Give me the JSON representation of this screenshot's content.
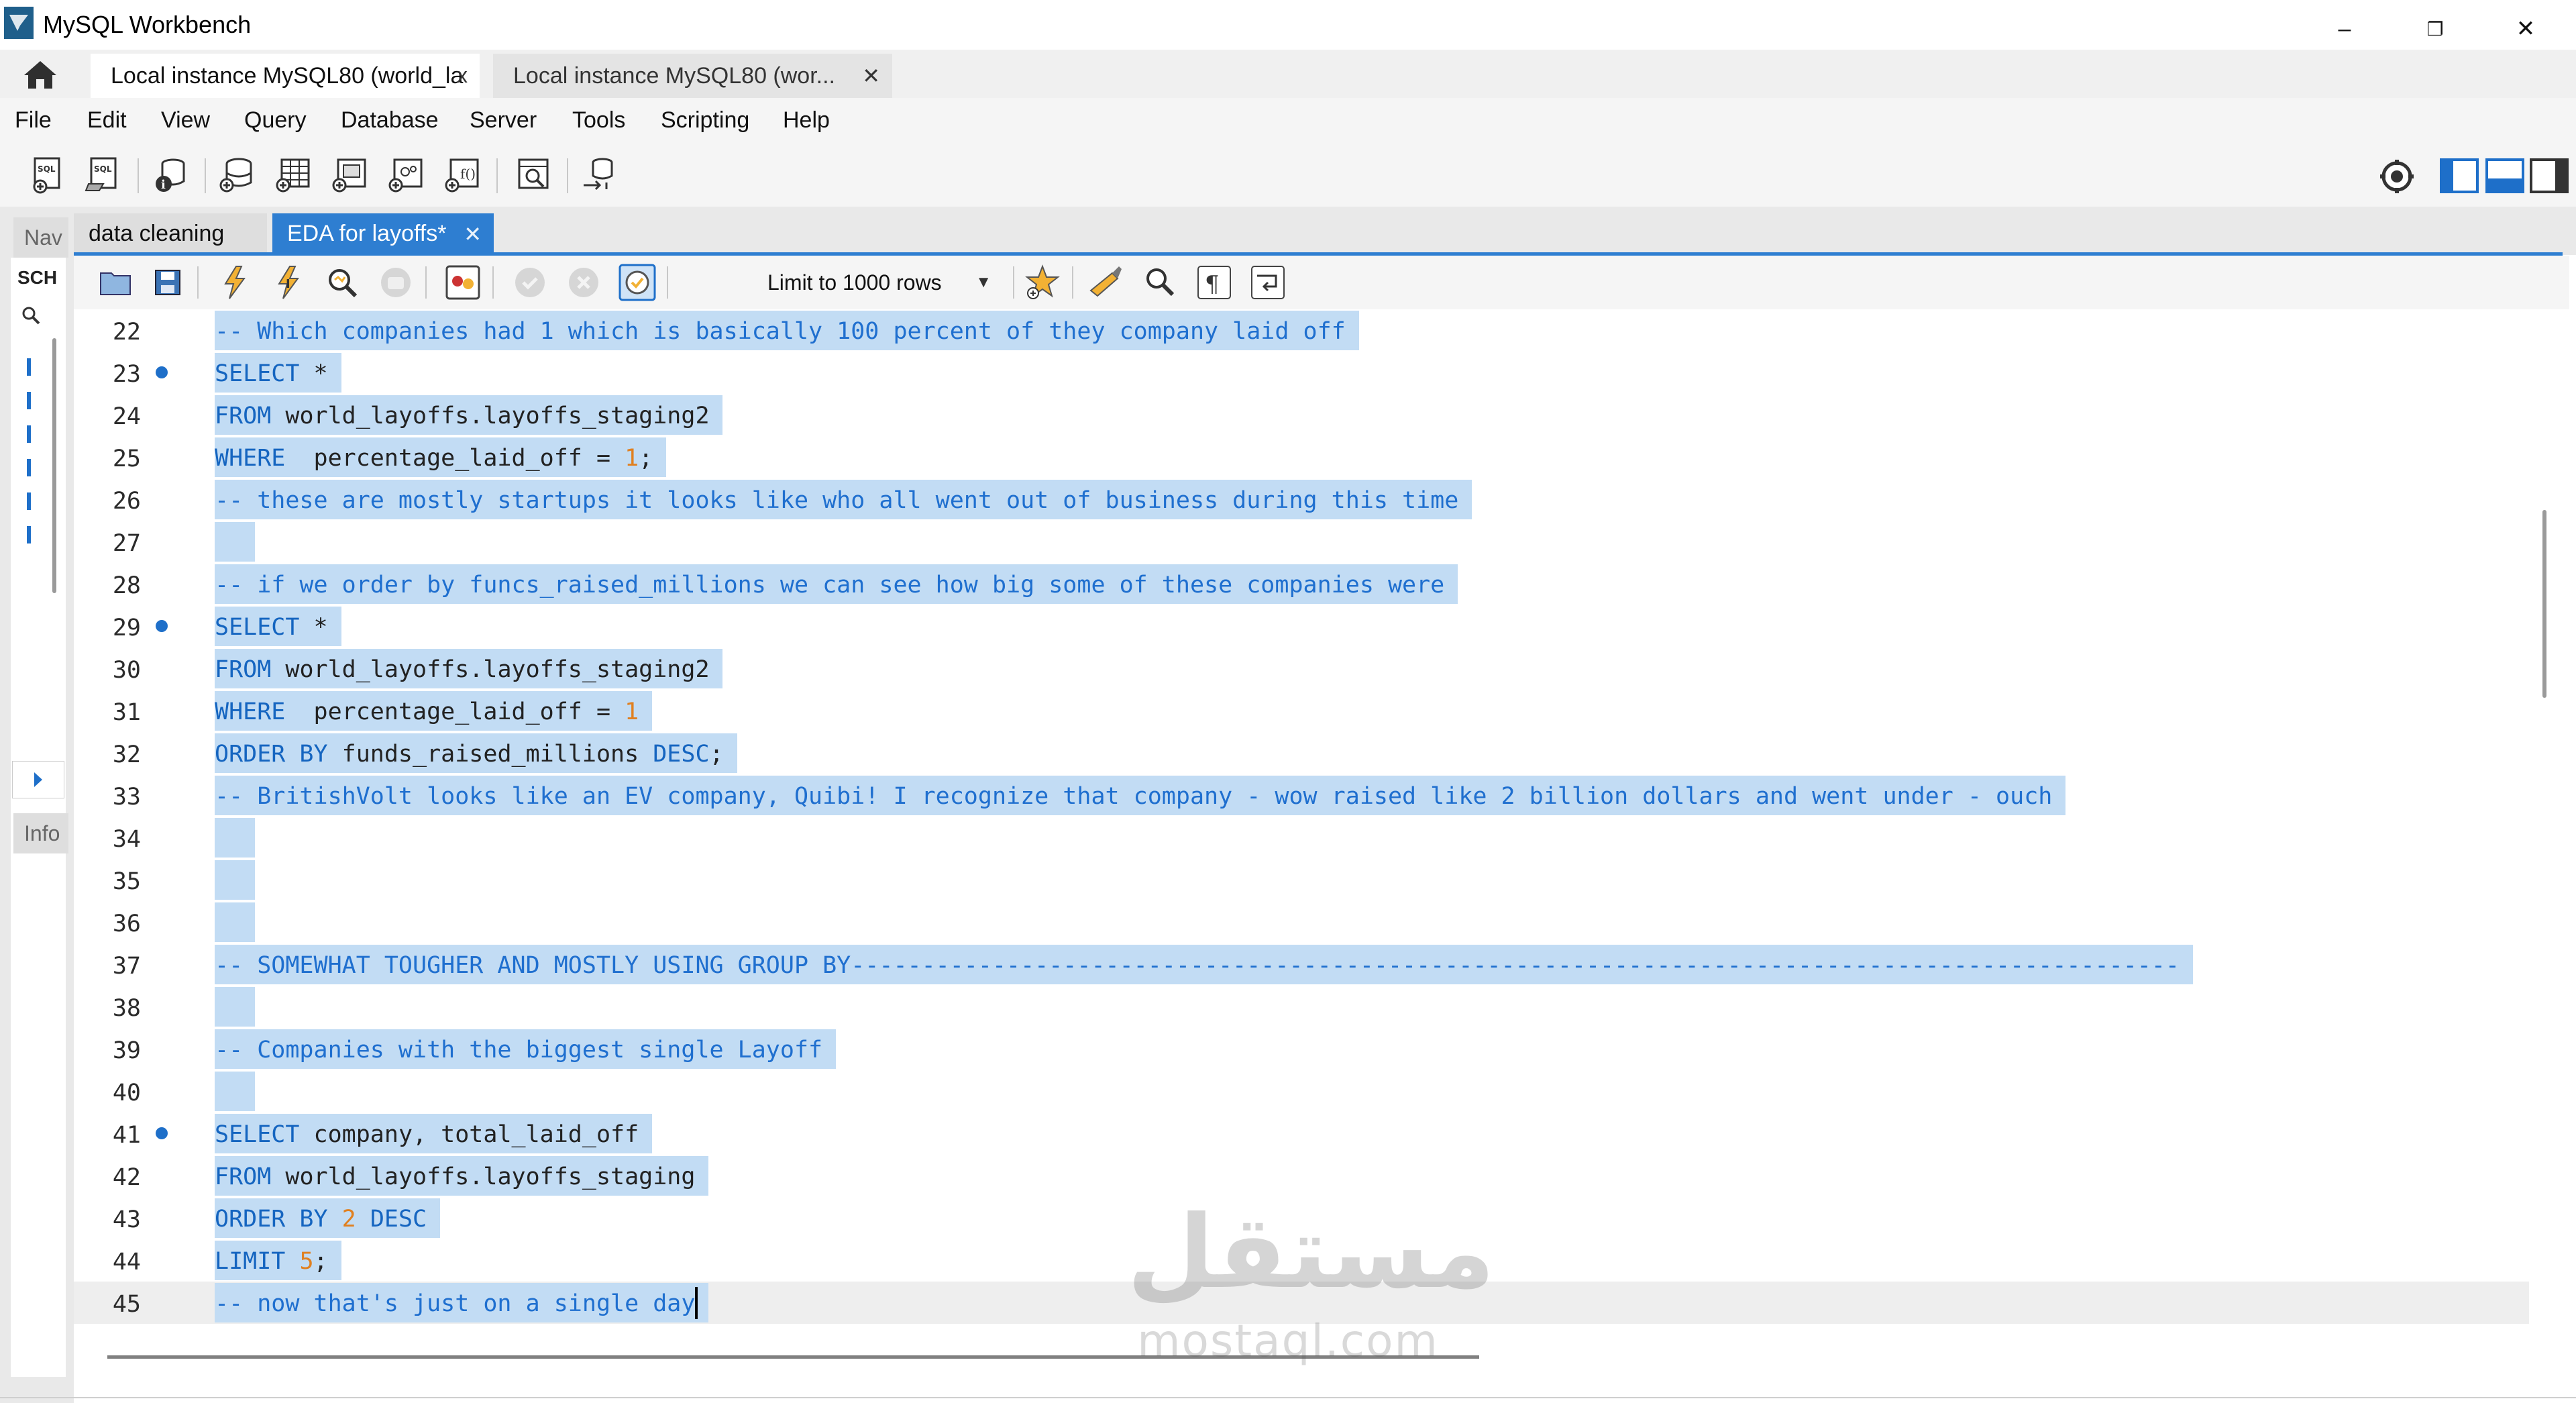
{
  "window": {
    "title": "MySQL Workbench",
    "minimize": "–",
    "maximize": "❐",
    "close": "✕"
  },
  "connection_tabs": [
    {
      "label": "Local instance MySQL80 (world_la",
      "close": "x",
      "active": true
    },
    {
      "label": "Local instance MySQL80 (wor...",
      "close": "✕",
      "active": false
    }
  ],
  "menu": [
    "File",
    "Edit",
    "View",
    "Query",
    "Database",
    "Server",
    "Tools",
    "Scripting",
    "Help"
  ],
  "navigator": {
    "tab_label": "Nav",
    "schemas_label": "SCH",
    "info_label": "Info"
  },
  "editor_tabs": [
    {
      "label": "data cleaning",
      "active": false
    },
    {
      "label": "EDA for layoffs*",
      "active": true,
      "close": "✕"
    }
  ],
  "editor_toolbar": {
    "limit_rows": "Limit to 1000 rows"
  },
  "code_lines": [
    {
      "n": "22",
      "bp": false,
      "sel": true,
      "tokens": [
        {
          "t": "-- Which companies had 1 which is basically 100 percent of they company laid off",
          "c": "cm"
        }
      ]
    },
    {
      "n": "23",
      "bp": true,
      "sel": true,
      "tokens": [
        {
          "t": "SELECT",
          "c": "kw"
        },
        {
          "t": " *",
          "c": "id"
        }
      ]
    },
    {
      "n": "24",
      "bp": false,
      "sel": true,
      "tokens": [
        {
          "t": "FROM",
          "c": "kw"
        },
        {
          "t": " world_layoffs.layoffs_staging2",
          "c": "id"
        }
      ]
    },
    {
      "n": "25",
      "bp": false,
      "sel": true,
      "tokens": [
        {
          "t": "WHERE",
          "c": "kw"
        },
        {
          "t": "  percentage_laid_off = ",
          "c": "id"
        },
        {
          "t": "1",
          "c": "num"
        },
        {
          "t": ";",
          "c": "id"
        }
      ]
    },
    {
      "n": "26",
      "bp": false,
      "sel": true,
      "tokens": [
        {
          "t": "-- these are mostly startups it looks like who all went out of business during this time",
          "c": "cm"
        }
      ]
    },
    {
      "n": "27",
      "bp": false,
      "sel": true,
      "tokens": []
    },
    {
      "n": "28",
      "bp": false,
      "sel": true,
      "tokens": [
        {
          "t": "-- if we order by funcs_raised_millions we can see how big some of these companies were",
          "c": "cm"
        }
      ]
    },
    {
      "n": "29",
      "bp": true,
      "sel": true,
      "tokens": [
        {
          "t": "SELECT",
          "c": "kw"
        },
        {
          "t": " *",
          "c": "id"
        }
      ]
    },
    {
      "n": "30",
      "bp": false,
      "sel": true,
      "tokens": [
        {
          "t": "FROM",
          "c": "kw"
        },
        {
          "t": " world_layoffs.layoffs_staging2",
          "c": "id"
        }
      ]
    },
    {
      "n": "31",
      "bp": false,
      "sel": true,
      "tokens": [
        {
          "t": "WHERE",
          "c": "kw"
        },
        {
          "t": "  percentage_laid_off = ",
          "c": "id"
        },
        {
          "t": "1",
          "c": "num"
        }
      ]
    },
    {
      "n": "32",
      "bp": false,
      "sel": true,
      "tokens": [
        {
          "t": "ORDER BY",
          "c": "kw"
        },
        {
          "t": " funds_raised_millions ",
          "c": "id"
        },
        {
          "t": "DESC",
          "c": "kw"
        },
        {
          "t": ";",
          "c": "id"
        }
      ]
    },
    {
      "n": "33",
      "bp": false,
      "sel": true,
      "tokens": [
        {
          "t": "-- BritishVolt looks like an EV company, Quibi! I recognize that company - wow raised like 2 billion dollars and went under - ouch",
          "c": "cm"
        }
      ]
    },
    {
      "n": "34",
      "bp": false,
      "sel": true,
      "tokens": []
    },
    {
      "n": "35",
      "bp": false,
      "sel": true,
      "tokens": []
    },
    {
      "n": "36",
      "bp": false,
      "sel": true,
      "tokens": []
    },
    {
      "n": "37",
      "bp": false,
      "sel": true,
      "tokens": [
        {
          "t": "-- SOMEWHAT TOUGHER AND MOSTLY USING GROUP BY----------------------------------------------------------------------------------------------",
          "c": "cm"
        }
      ]
    },
    {
      "n": "38",
      "bp": false,
      "sel": true,
      "tokens": []
    },
    {
      "n": "39",
      "bp": false,
      "sel": true,
      "tokens": [
        {
          "t": "-- Companies with the biggest single Layoff",
          "c": "cm"
        }
      ]
    },
    {
      "n": "40",
      "bp": false,
      "sel": true,
      "tokens": []
    },
    {
      "n": "41",
      "bp": true,
      "sel": true,
      "tokens": [
        {
          "t": "SELECT",
          "c": "kw"
        },
        {
          "t": " company, total_laid_off",
          "c": "id"
        }
      ]
    },
    {
      "n": "42",
      "bp": false,
      "sel": true,
      "tokens": [
        {
          "t": "FROM",
          "c": "kw"
        },
        {
          "t": " world_layoffs.layoffs_staging",
          "c": "id"
        }
      ]
    },
    {
      "n": "43",
      "bp": false,
      "sel": true,
      "tokens": [
        {
          "t": "ORDER BY",
          "c": "kw"
        },
        {
          "t": " ",
          "c": "id"
        },
        {
          "t": "2",
          "c": "num"
        },
        {
          "t": " ",
          "c": "id"
        },
        {
          "t": "DESC",
          "c": "kw"
        }
      ]
    },
    {
      "n": "44",
      "bp": false,
      "sel": true,
      "tokens": [
        {
          "t": "LIMIT",
          "c": "kw"
        },
        {
          "t": " ",
          "c": "id"
        },
        {
          "t": "5",
          "c": "num"
        },
        {
          "t": ";",
          "c": "id"
        }
      ]
    },
    {
      "n": "45",
      "bp": false,
      "sel": true,
      "current": true,
      "caret": true,
      "tokens": [
        {
          "t": "-- now that's just on a single day",
          "c": "cm"
        }
      ]
    }
  ],
  "watermark": {
    "arabic": "مستقل",
    "latin": "mostaql.com"
  },
  "colors": {
    "accent": "#2e7ed1",
    "selection": "#c2dcf4",
    "comment": "#1f6fcf",
    "keyword": "#1565c0",
    "number": "#e08020",
    "breakpoint": "#1e6fc9"
  }
}
